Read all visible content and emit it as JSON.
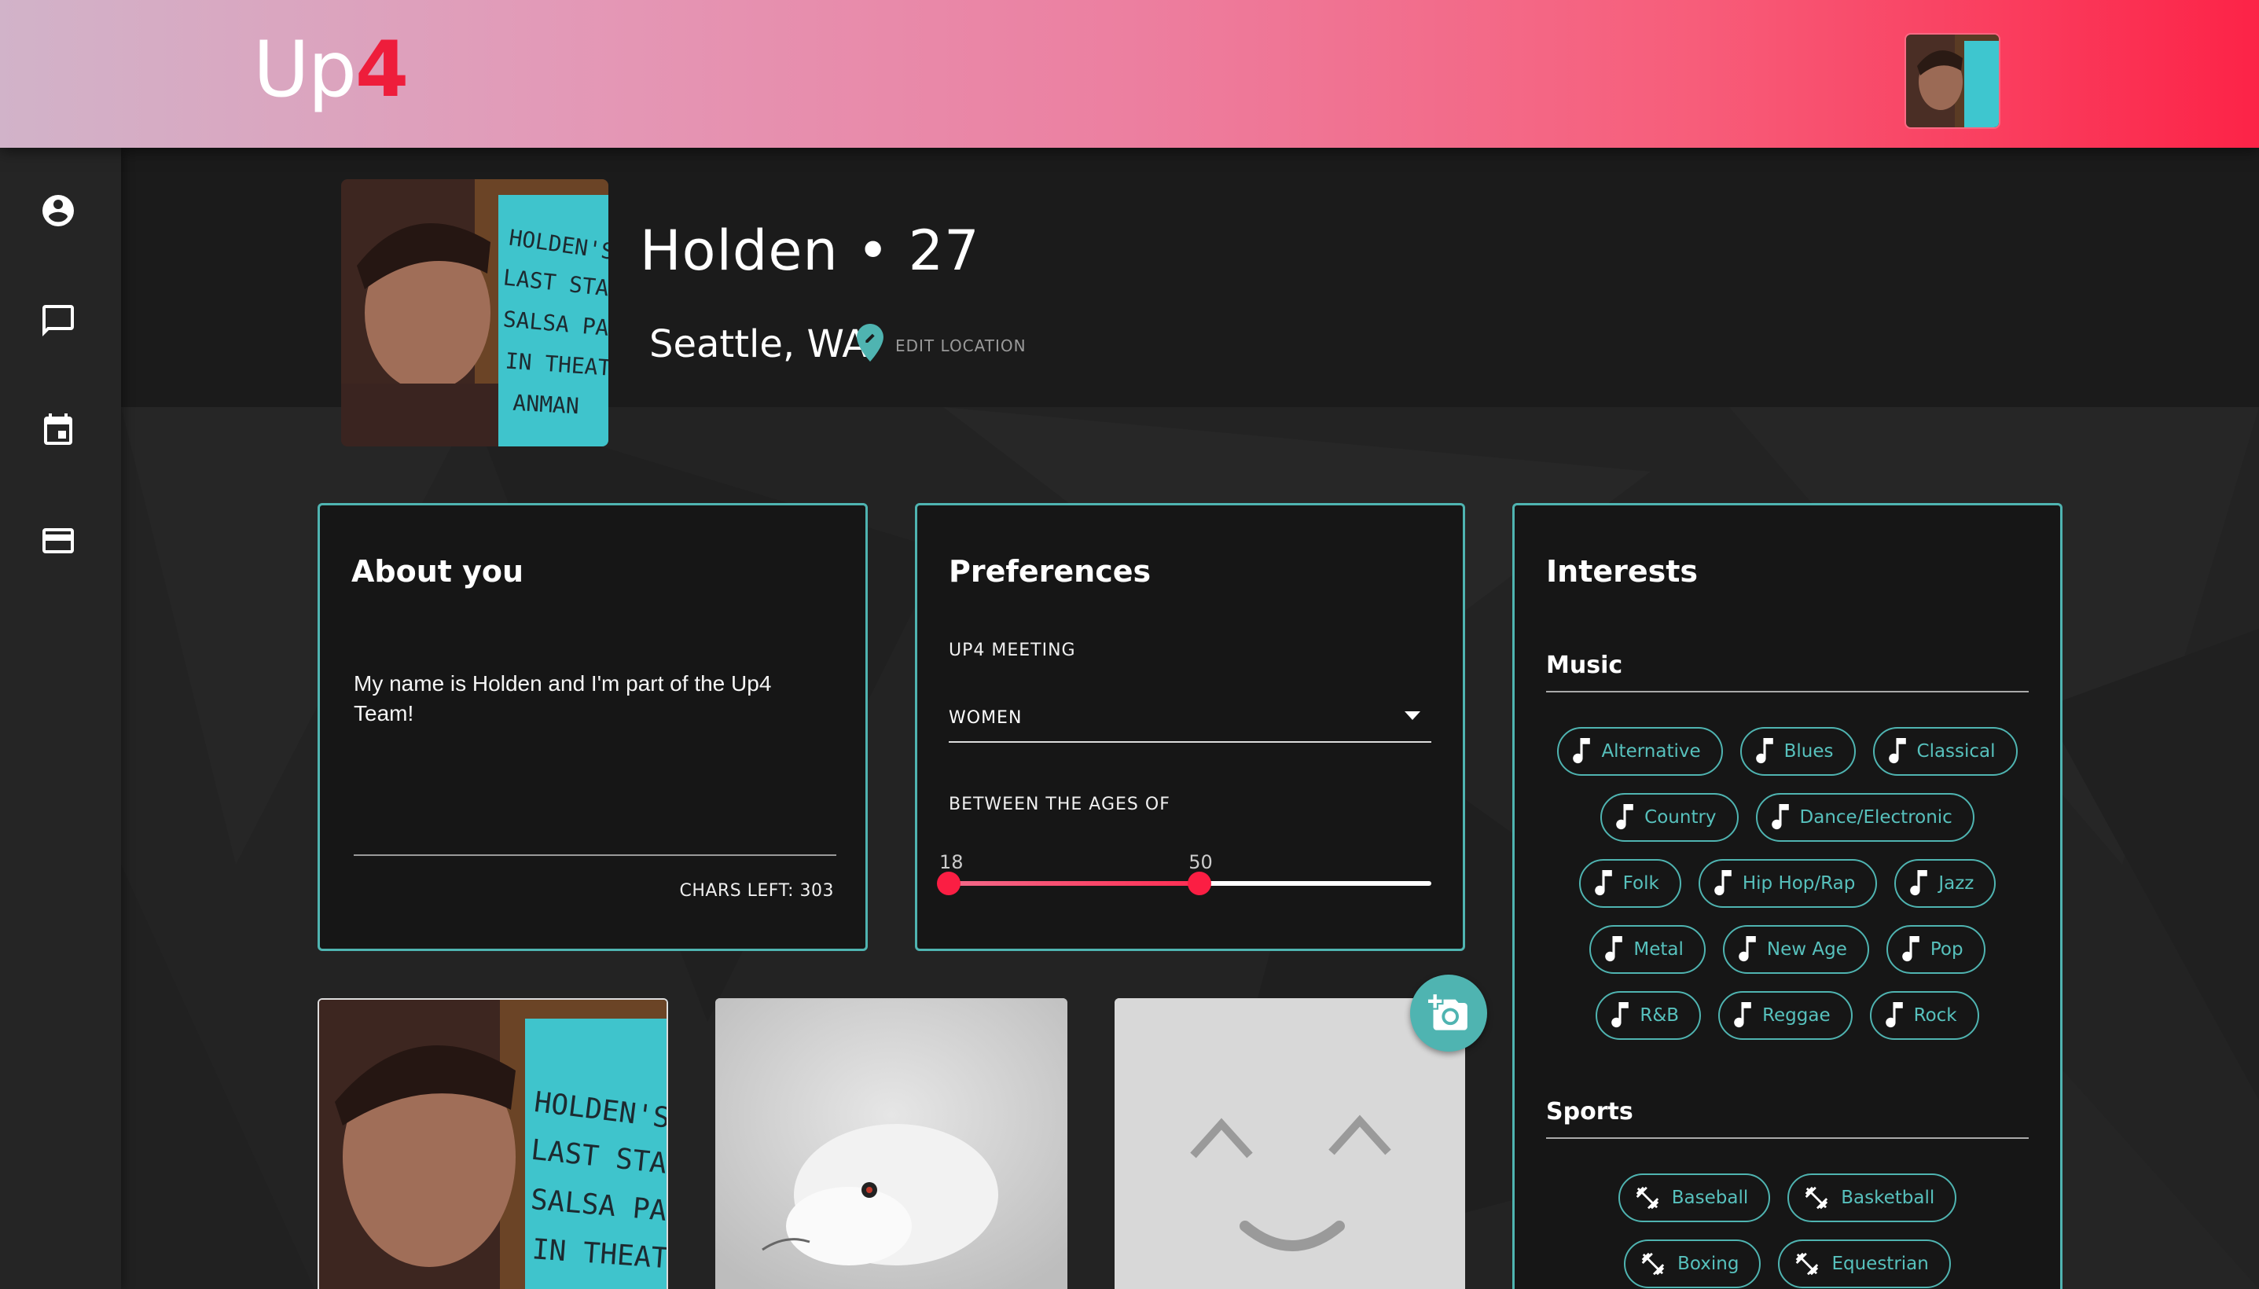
{
  "app": {
    "logo_up": "Up",
    "logo_four": "4"
  },
  "sidebar": {
    "items": [
      {
        "icon": "account-circle-icon"
      },
      {
        "icon": "chat-icon"
      },
      {
        "icon": "calendar-icon"
      },
      {
        "icon": "credit-card-icon"
      }
    ]
  },
  "profile": {
    "name_age": "Holden • 27",
    "location": "Seattle, WA",
    "edit_location": "EDIT LOCATION"
  },
  "about": {
    "title": "About you",
    "text": "My name is Holden and I'm part of the Up4 Team!",
    "chars_left": "CHARS LEFT: 303"
  },
  "preferences": {
    "title": "Preferences",
    "meeting_label": "UP4 MEETING",
    "meeting_value": "WOMEN",
    "ages_label": "BETWEEN THE AGES OF",
    "age_min": "18",
    "age_max": "50",
    "age_min_fraction": 0.0,
    "age_max_fraction": 0.52
  },
  "interests": {
    "title": "Interests",
    "music_title": "Music",
    "music": [
      "Alternative",
      "Blues",
      "Classical",
      "Country",
      "Dance/Electronic",
      "Folk",
      "Hip Hop/Rap",
      "Jazz",
      "Metal",
      "New Age",
      "Pop",
      "R&B",
      "Reggae",
      "Rock"
    ],
    "sports_title": "Sports",
    "sports": [
      "Baseball",
      "Basketball",
      "Boxing",
      "Equestrian"
    ]
  },
  "colors": {
    "accent": "#4fb4b1",
    "brand_red": "#ee1d3b"
  }
}
